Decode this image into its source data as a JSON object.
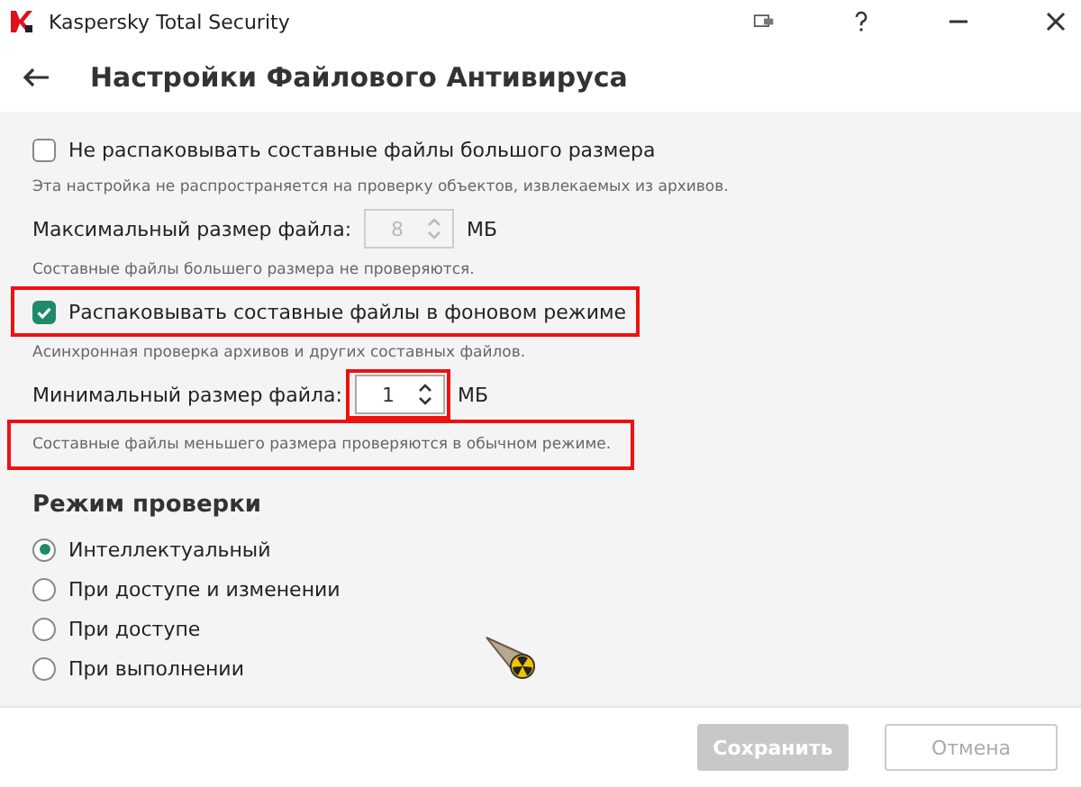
{
  "window": {
    "title": "Kaspersky Total Security"
  },
  "page": {
    "title": "Настройки Файлового Антивируса"
  },
  "settings": [
    {
      "kind": "checkbox",
      "label": "Не распаковывать составные файлы большого размера",
      "checked": false
    },
    {
      "kind": "note",
      "text": "Эта настройка не распространяется на проверку объектов, извлекаемых из архивов."
    },
    {
      "kind": "spinner",
      "label": "Максимальный размер файла:",
      "value": "8",
      "unit": "МБ",
      "disabled": true
    },
    {
      "kind": "note",
      "text": "Составные файлы большего размера не проверяются."
    },
    {
      "kind": "checkbox",
      "label": "Распаковывать составные файлы в фоновом режиме",
      "checked": true
    },
    {
      "kind": "note",
      "text": "Асинхронная проверка архивов и других составных файлов."
    },
    {
      "kind": "spinner",
      "label": "Минимальный размер файла:",
      "value": "1",
      "unit": "МБ",
      "disabled": false
    },
    {
      "kind": "note",
      "text": "Составные файлы меньшего размера проверяются в обычном режиме."
    }
  ],
  "scan_mode": {
    "title": "Режим проверки",
    "options": [
      {
        "label": "Интеллектуальный",
        "selected": true
      },
      {
        "label": "При доступе и изменении",
        "selected": false
      },
      {
        "label": "При доступе",
        "selected": false
      },
      {
        "label": "При выполнении",
        "selected": false
      }
    ]
  },
  "buttons": [
    {
      "label": "Сохранить",
      "kind": "primary",
      "disabled": true
    },
    {
      "label": "Отмена",
      "kind": "secondary",
      "disabled": true
    }
  ]
}
